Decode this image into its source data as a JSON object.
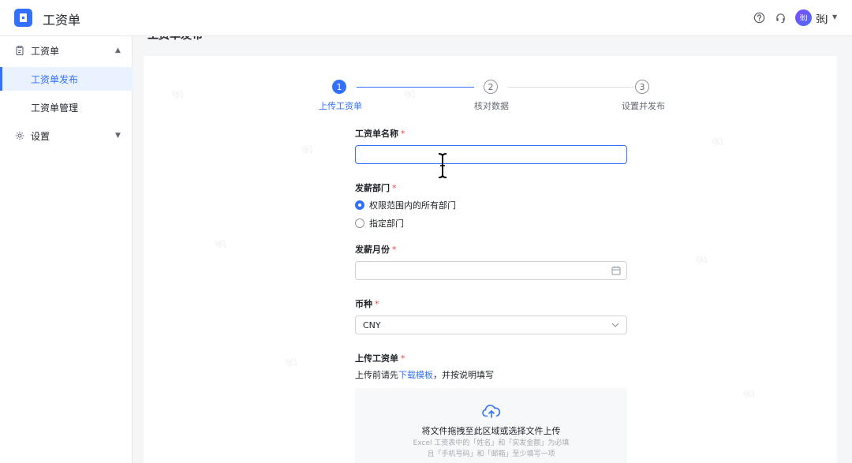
{
  "header": {
    "app_title": "工资单",
    "user_avatar_text": "张J",
    "user_name": "张J",
    "help_icon": "question-circle-icon",
    "support_icon": "headset-icon"
  },
  "sidebar": {
    "group_payroll": "工资单",
    "items": [
      {
        "label": "工资单发布",
        "active": true
      },
      {
        "label": "工资单管理",
        "active": false
      }
    ],
    "group_settings": "设置"
  },
  "main": {
    "page_title": "工资单发布",
    "steps": [
      {
        "num": "1",
        "label": "上传工资单",
        "active": true
      },
      {
        "num": "2",
        "label": "核对数据",
        "active": false
      },
      {
        "num": "3",
        "label": "设置并发布",
        "active": false
      }
    ],
    "form": {
      "name_label": "工资单名称",
      "name_value": "",
      "dept_label": "发薪部门",
      "dept_options": [
        "权限范围内的所有部门",
        "指定部门"
      ],
      "dept_selected": "权限范围内的所有部门",
      "month_label": "发薪月份",
      "month_value": "",
      "currency_label": "币种",
      "currency_value": "CNY",
      "upload_label": "上传工资单",
      "required_mark": "*",
      "hint_prefix": "上传前请先",
      "hint_link": "下载模板",
      "hint_suffix": "，并按说明填写",
      "upload_title": "将文件拖拽至此区域或选择文件上传",
      "upload_sub1": "Excel 工资表中的「姓名」和「实发金额」为必填",
      "upload_sub2": "且「手机号码」和「邮箱」至少填写一项"
    },
    "watermark": "张J"
  },
  "colors": {
    "primary": "#3370ff",
    "required": "#f54a45"
  }
}
